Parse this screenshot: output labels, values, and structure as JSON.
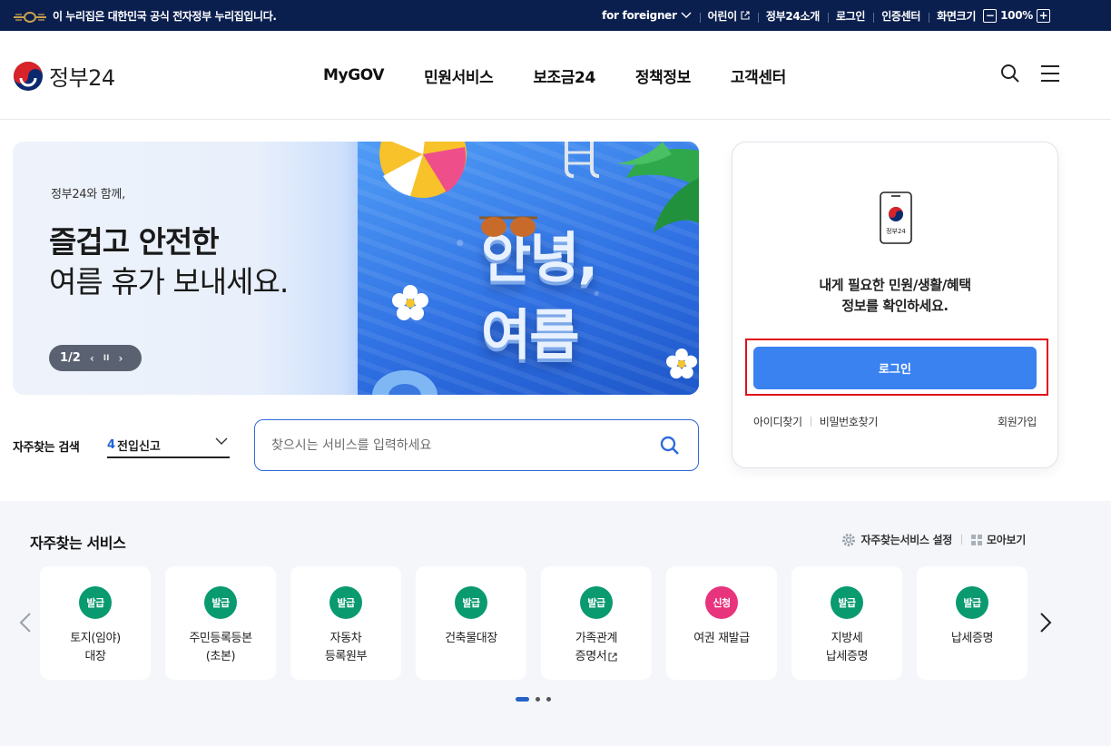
{
  "gov_bar": {
    "notice": "이 누리집은 대한민국 공식 전자정부 누리집입니다.",
    "foreigner": "for foreigner",
    "kids": "어린이",
    "about": "정부24소개",
    "login": "로그인",
    "cert": "인증센터",
    "screen_size_label": "화면크기",
    "zoom_minus": "−",
    "zoom_value": "100%",
    "zoom_plus": "+"
  },
  "header": {
    "logo_text": "정부24",
    "nav": [
      "MyGOV",
      "민원서비스",
      "보조금24",
      "정책정보",
      "고객센터"
    ],
    "icons": [
      "search-icon",
      "menu-icon"
    ]
  },
  "banner": {
    "subtitle": "정부24와 함께,",
    "title_line1": "즐겁고 안전한",
    "title_line2": "여름 휴가 보내세요.",
    "art_line1": "안녕,",
    "art_line2": "여름",
    "pager": "1/2",
    "prev": "‹",
    "pause": "II",
    "next": "›"
  },
  "search": {
    "label": "자주찾는 검색",
    "selected_num": "4",
    "selected_text": "전입신고",
    "placeholder": "찾으시는 서비스를 입력하세요"
  },
  "login_card": {
    "phone_label": "정부24",
    "message_line1": "내게 필요한 민원/생활/혜택",
    "message_line2": "정보를 확인하세요.",
    "login_button": "로그인",
    "find_id": "아이디찾기",
    "find_pw": "비밀번호찾기",
    "join": "회원가입"
  },
  "favorites": {
    "title": "자주찾는 서비스",
    "settings": "자주찾는서비스 설정",
    "view_all": "모아보기",
    "cards": [
      {
        "badge": "발급",
        "color": "#0a9a6f",
        "line1": "토지(임야)",
        "line2": "대장"
      },
      {
        "badge": "발급",
        "color": "#0a9a6f",
        "line1": "주민등록등본",
        "line2": "(초본)"
      },
      {
        "badge": "발급",
        "color": "#0a9a6f",
        "line1": "자동차",
        "line2": "등록원부"
      },
      {
        "badge": "발급",
        "color": "#0a9a6f",
        "line1": "건축물대장",
        "line2": ""
      },
      {
        "badge": "발급",
        "color": "#0a9a6f",
        "line1": "가족관계",
        "line2": "증명서"
      },
      {
        "badge": "신청",
        "color": "#e8337d",
        "line1": "여권 재발급",
        "line2": ""
      },
      {
        "badge": "발급",
        "color": "#0a9a6f",
        "line1": "지방세",
        "line2": "납세증명"
      },
      {
        "badge": "발급",
        "color": "#0a9a6f",
        "line1": "납세증명",
        "line2": ""
      }
    ]
  },
  "colors": {
    "gov_bar": "#0b1f4f",
    "primary": "#3a82f0",
    "issue_badge": "#0a9a6f",
    "apply_badge": "#e8337d",
    "highlight_outline": "#e0101b"
  }
}
